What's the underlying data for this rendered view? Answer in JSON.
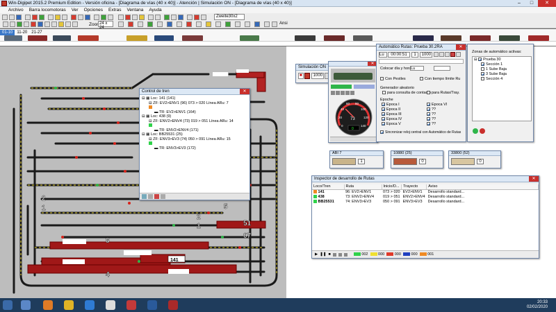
{
  "titlebar": {
    "title": "Win-Digipet 2015.2 Premium Edition - Versión oficina - [Diagrama de vías (40 x 40)] - Atención | Simulación ON - [Diagrama de vías (40 x 40)]"
  },
  "menu": [
    "Archivo",
    "Barra locomotoras",
    "Ver",
    "Opciones",
    "Extras",
    "Ventana",
    "Ayuda"
  ],
  "toolbar": {
    "zoom_label": "Zoom",
    "zoom_value": "24 x 24",
    "layout_value": "Zweite30x2",
    "ansi_label": "Ansi"
  },
  "locobar": {
    "tabs": [
      "01-10",
      "11-20",
      "21-27"
    ],
    "active_tab": "01-10"
  },
  "simulation": {
    "title": "Simulación ON",
    "speed": "1000"
  },
  "train_control": {
    "title": "Control de tren",
    "items": [
      {
        "loc": "Loc: 141 (141)",
        "zf": "ZF: EV2>ENV1 (96) 073 > 020  Línea ARu: 7",
        "tr": "TR: EV2>ENV1 (164)",
        "color": "#f08a24"
      },
      {
        "loc": "Loc: 438 (9)",
        "zf": "ZF: ENV2>ENV4 (73) 019 > 051  Línea ARu: 14",
        "tr": "TR: ENV2>ENV4 (171)",
        "color": "#2fd24a"
      },
      {
        "loc": "Loc: BB25531 (25)",
        "zf": "ZF: ENV3>EV3 (74) 050 > 091  Línea ARu: 15",
        "tr": "TR: ENV3>EV3 (172)",
        "color": "#2fd24a"
      }
    ]
  },
  "loco_windows": [
    {
      "title": "ABI 7",
      "speed": "1"
    },
    {
      "title": "10880 (25)",
      "speed": "0"
    },
    {
      "title": "33800 (52)",
      "speed": "0"
    }
  ],
  "speedometer": {
    "ticks": [
      "0",
      "20",
      "40",
      "60",
      "80",
      "100",
      "120",
      "140"
    ],
    "value_label": "73",
    "display": "0"
  },
  "auto_routes": {
    "title": "Automático Rutas: Prueba 30.2RA",
    "time": "00:00:51",
    "day_value": "1",
    "speed_value": "1000",
    "set_day_label": "Colocar día y hora:",
    "day_select": "Lu",
    "opt_pestles": "Con Pestles",
    "opt_tiempo": "Con tiempo límite Ru",
    "generator_label": "Generador aleatorio",
    "opt_consulta": "para consulta de contacto",
    "opt_rutas": "para Rutas/Tray.",
    "epoch_label": "Epoche",
    "epochs_left": [
      "Epoca I",
      "Epoca II",
      "Epoca III",
      "Epoca IV",
      "Epoca V"
    ],
    "epochs_right": [
      "Epoca VI",
      "??",
      "??",
      "??",
      "??"
    ],
    "sync_label": "Sincronizar reloj central con Automático de Rutas"
  },
  "zones": {
    "title": "Zonas de automático activas:",
    "root": "Prueba 30",
    "items": [
      {
        "label": "Sección 1",
        "checked": true
      },
      {
        "label": "1 Sube Baja",
        "checked": false
      },
      {
        "label": "3 Sube Baja",
        "checked": true
      },
      {
        "label": "Sección 4",
        "checked": false
      }
    ]
  },
  "inspector": {
    "title": "Inspector de desarrollo de Rutas",
    "columns": [
      "Loco/Tren",
      "Ruta",
      "Inicio/D...",
      "Trayecto",
      "Aviso"
    ],
    "rows": [
      {
        "loco": "141",
        "color": "#f08a24",
        "ruta": "96: EV2>ENV1",
        "inicio": "073 > 020",
        "trayecto": "EV2>ENV1",
        "aviso": "Desarrollo standard..."
      },
      {
        "loco": "438",
        "color": "#2fd24a",
        "ruta": "73: ENV2>ENV4",
        "inicio": "019 > 051",
        "trayecto": "ENV2>ENV4",
        "aviso": "Desarrollo standard..."
      },
      {
        "loco": "BB25531",
        "color": "#2fd24a",
        "ruta": "74: ENV3>EV3",
        "inicio": "050 > 091",
        "trayecto": "ENV3>EV3",
        "aviso": "Desarrollo standard..."
      }
    ],
    "legend": [
      {
        "color": "#2fd24a",
        "label": "002"
      },
      {
        "color": "#f0e030",
        "label": "000"
      },
      {
        "color": "#e03a2a",
        "label": "000"
      },
      {
        "color": "#2040c0",
        "label": "000"
      },
      {
        "color": "#f08a24",
        "label": "001"
      }
    ]
  },
  "track_labels": [
    "6",
    "5",
    "8",
    "4",
    "2",
    "1",
    "51",
    "07",
    "141"
  ],
  "clock": {
    "time": "20:33",
    "date": "02/02/2020"
  }
}
